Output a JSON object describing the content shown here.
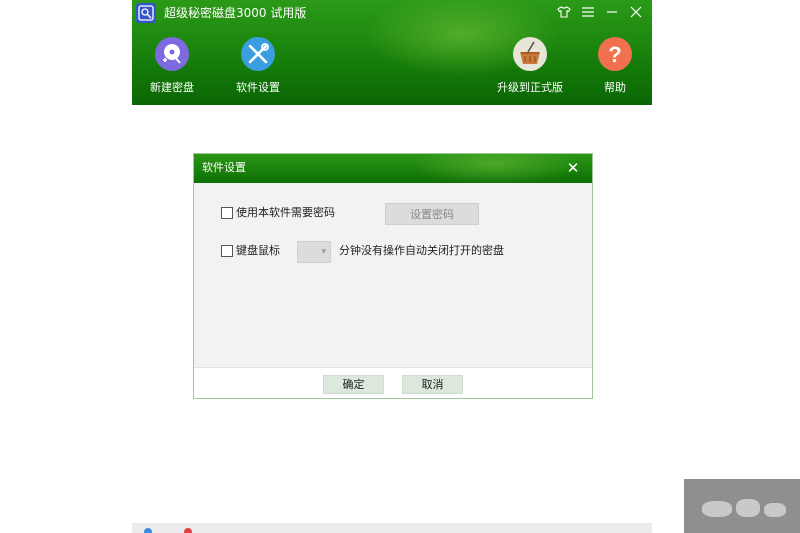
{
  "app": {
    "title": "超级秘密磁盘3000 试用版",
    "toolbar": [
      {
        "id": "new-disk",
        "label": "新建密盘",
        "icon": "disk-plus-icon"
      },
      {
        "id": "settings",
        "label": "软件设置",
        "icon": "wrench-screwdriver-icon"
      },
      {
        "id": "upgrade",
        "label": "升级到正式版",
        "icon": "basket-icon"
      },
      {
        "id": "help",
        "label": "帮助",
        "icon": "question-icon"
      }
    ],
    "window_controls": [
      "skin-icon",
      "menu-icon",
      "minimize-icon",
      "close-icon"
    ]
  },
  "dialog": {
    "title": "软件设置",
    "require_password": {
      "label": "使用本软件需要密码",
      "checked": false
    },
    "set_password_button": "设置密码",
    "auto_close": {
      "label": "键盘鼠标",
      "checked": false,
      "minutes_value": "",
      "suffix": "分钟没有操作自动关闭打开的密盘"
    },
    "ok_button": "确定",
    "cancel_button": "取消"
  },
  "colors": {
    "header_green": "#1f8a10",
    "new_disk_icon_bg": "#7d6ae0",
    "settings_icon_bg": "#3a9ee0",
    "upgrade_icon_bg": "#e8e4d8",
    "help_icon_bg": "#f07050"
  }
}
